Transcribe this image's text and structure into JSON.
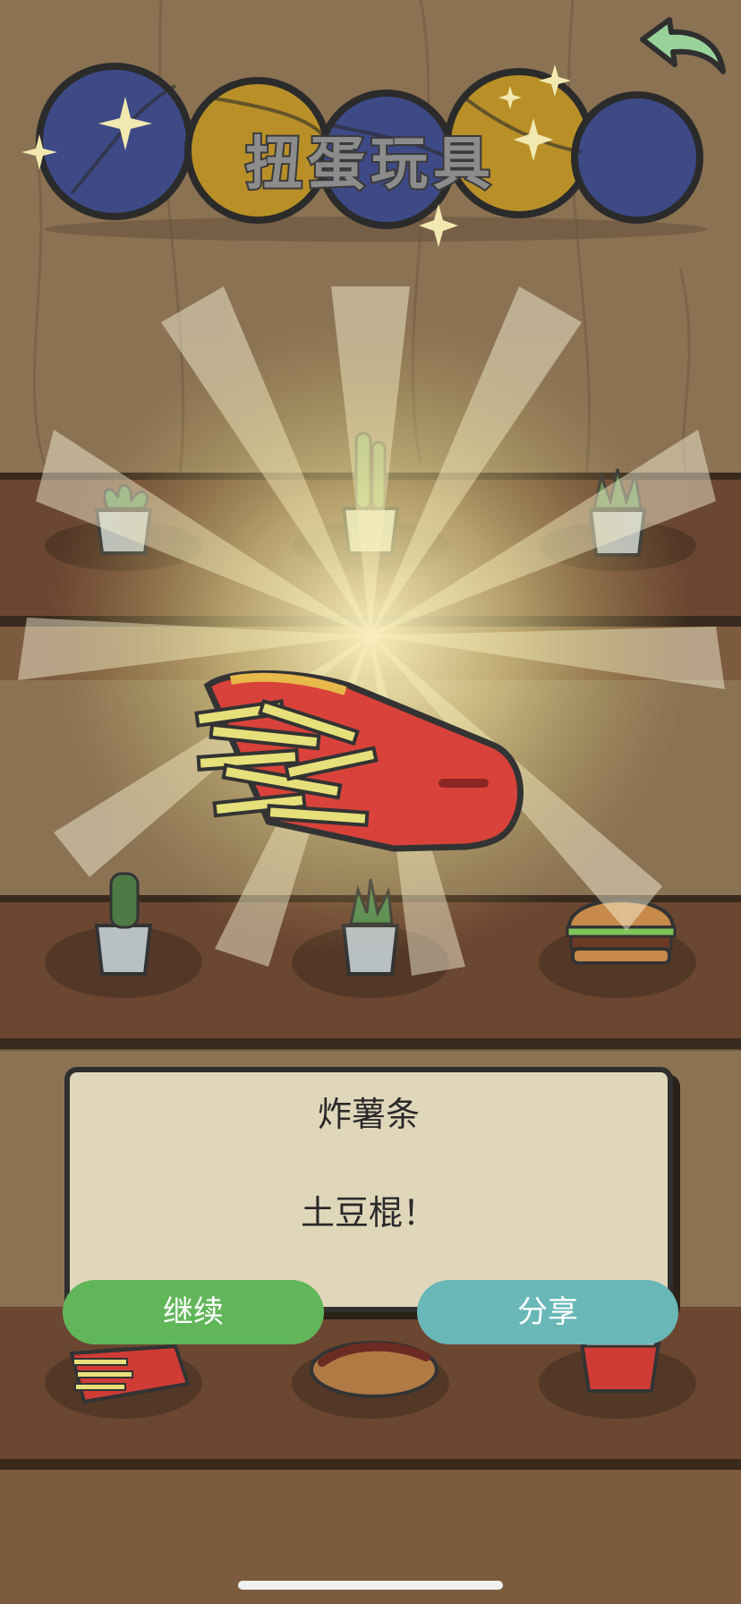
{
  "header": {
    "title": "扭蛋玩具",
    "back_icon": "back-arrow-icon",
    "back_color": "#9ad39a"
  },
  "reward": {
    "item_icon": "french-fries-icon",
    "name": "炸薯条",
    "description": "土豆棍！"
  },
  "buttons": {
    "continue_label": "继续",
    "share_label": "分享"
  },
  "shelf_items": [
    "plant-pot-icon",
    "cactus-pot-icon",
    "succulent-pot-icon",
    "cactus-pot-icon",
    "aloe-pot-icon",
    "hamburger-icon",
    "french-fries-icon",
    "hotdog-icon",
    "drink-cup-icon"
  ],
  "colors": {
    "wall": "#8a7253",
    "shelf": "#6b4631",
    "capsule_blue": "#3e4a86",
    "capsule_yellow": "#b99028",
    "dialog_bg": "#e0d7bb",
    "continue_button": "#62b65a",
    "share_button": "#6ab7b8"
  }
}
